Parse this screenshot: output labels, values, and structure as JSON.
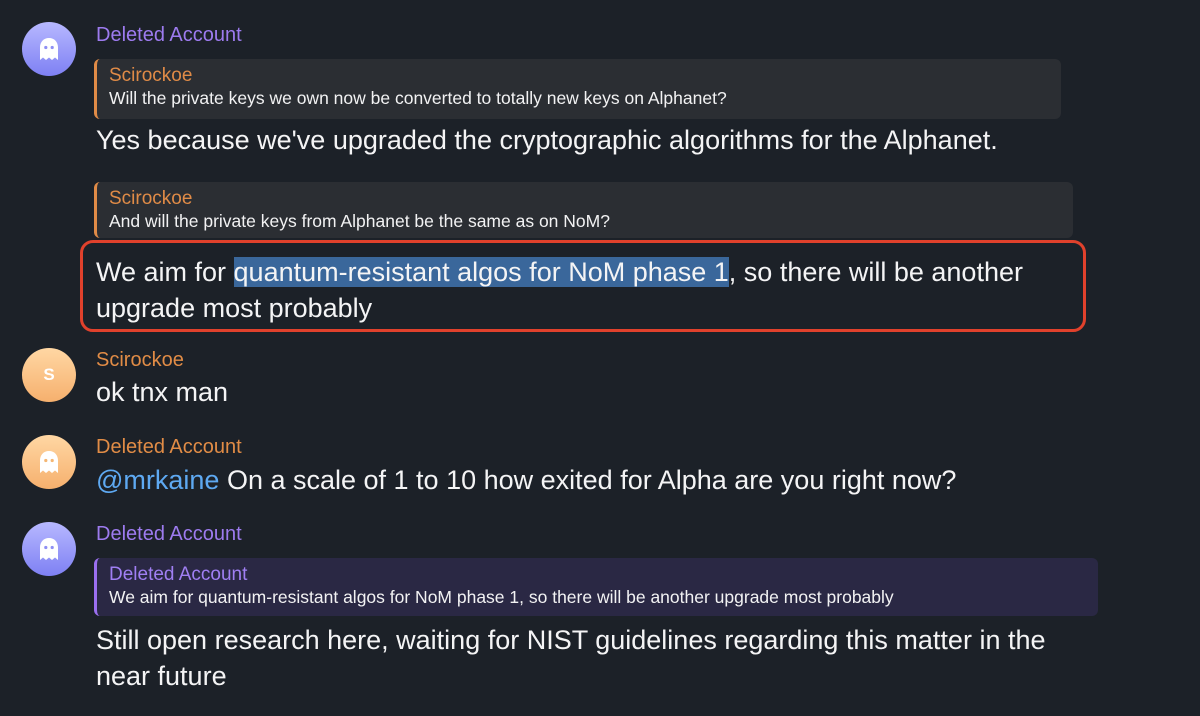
{
  "messages": [
    {
      "author": "Deleted Account",
      "avatar_icon": "ghost-icon",
      "reply": {
        "author": "Scirockoe",
        "text": "Will the private keys we own now be converted to totally new keys on Alphanet?"
      },
      "text": "Yes because we've upgraded the cryptographic algorithms for the Alphanet."
    },
    {
      "reply": {
        "author": "Scirockoe",
        "text": "And will the private keys from Alphanet be the same as on NoM?"
      },
      "text_before": "We aim for ",
      "text_selected": "quantum-resistant algos for NoM phase 1",
      "text_after": ", so there will be another",
      "text_line2": "upgrade most probably"
    },
    {
      "author": "Scirockoe",
      "avatar_initial": "S",
      "text": "ok tnx man"
    },
    {
      "author": "Deleted Account",
      "avatar_icon": "ghost-icon",
      "mention": "@mrkaine",
      "text": " On a scale of 1 to 10 how exited for Alpha are you right now?"
    },
    {
      "author": "Deleted Account",
      "avatar_icon": "ghost-icon",
      "reply": {
        "author": "Deleted Account",
        "text": "We aim for quantum-resistant algos for NoM phase 1, so there will be another upgrade most probably"
      },
      "text_line1": "Still open research here, waiting for NIST guidelines regarding this matter in the",
      "text_line2": "near future"
    }
  ],
  "colors": {
    "background": "#1c2128",
    "deleted_account_name": "#9d7bef",
    "scirockoe_name": "#e18c46",
    "selection_highlight": "#3a679b",
    "annotation_outline": "#e0412c",
    "mention": "#5ea9f2"
  }
}
